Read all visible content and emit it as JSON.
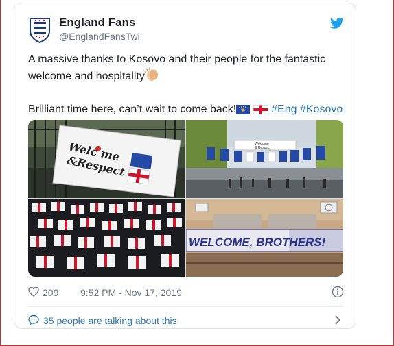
{
  "tweet": {
    "author_name": "England Fans",
    "author_handle": "@EnglandFansTwi",
    "line1": "A massive thanks to Kosovo and their people for the fantastic",
    "line2": "welcome and hospitality",
    "line3": "Brilliant time here, can’t wait to come back!",
    "hashtag1": "#Eng",
    "hashtag2": "#Kosovo",
    "likes": "209",
    "timestamp": "9:52 PM - Nov 17, 2019",
    "talking": "35 people are talking about this"
  },
  "media": {
    "banner1_line1": "Welc me",
    "banner1_line2": "&Respect",
    "banner2": "WELCOME, BROTHERS!",
    "street_banner_line1": "Welcome",
    "street_banner_line2": "& Respect"
  },
  "icons": {
    "avatar": "three-lions-crest-icon",
    "platform": "twitter-bird-icon",
    "like": "heart-icon",
    "info": "info-icon",
    "reply": "speech-bubble-icon",
    "chevron": "chevron-right-icon"
  },
  "colors": {
    "link": "#2b7bb9",
    "twitter_blue": "#1da1f2",
    "muted": "#697882",
    "outer_border": "#d6262b"
  }
}
